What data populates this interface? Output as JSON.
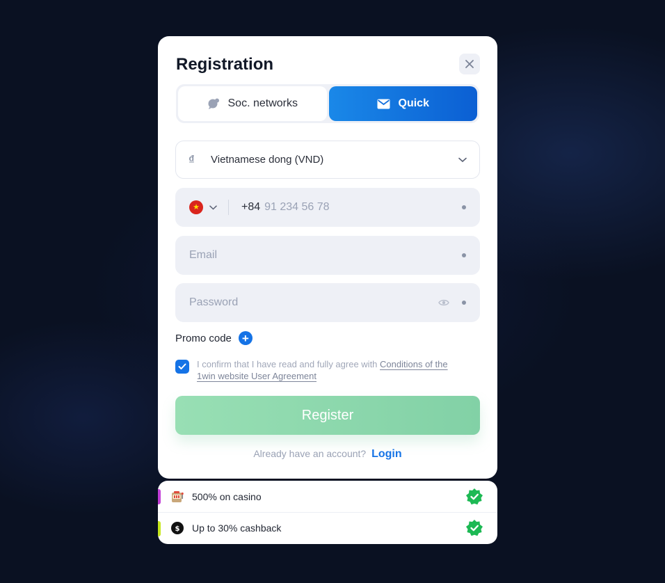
{
  "modal": {
    "title": "Registration",
    "tabs": [
      {
        "label": "Soc. networks",
        "icon": "chat-bubbles-icon",
        "active": false
      },
      {
        "label": "Quick",
        "icon": "envelope-icon",
        "active": true
      }
    ],
    "currency": {
      "symbol": "₫",
      "value": "Vietnamese dong (VND)"
    },
    "phone": {
      "dial_code": "+84",
      "placeholder": "91 234 56 78",
      "country": "Vietnam"
    },
    "email": {
      "placeholder": "Email"
    },
    "password": {
      "placeholder": "Password"
    },
    "promo": {
      "label": "Promo code",
      "plus": "+"
    },
    "agreement": {
      "checked": true,
      "text": "I confirm that I have read and fully agree with ",
      "link": "Conditions of the 1win website User Agreement"
    },
    "register_label": "Register",
    "login": {
      "prompt": "Already have an account?",
      "link": "Login"
    }
  },
  "bonuses": [
    {
      "text": "500% on casino",
      "accent": "#c23fd6",
      "icon": "slot-machine-icon"
    },
    {
      "text": "Up to 30% cashback",
      "accent": "#c6e61e",
      "icon": "cashback-coin-icon"
    }
  ],
  "colors": {
    "primary": "#1573e6",
    "register": "#8fd9ae",
    "badge": "#1db954"
  }
}
